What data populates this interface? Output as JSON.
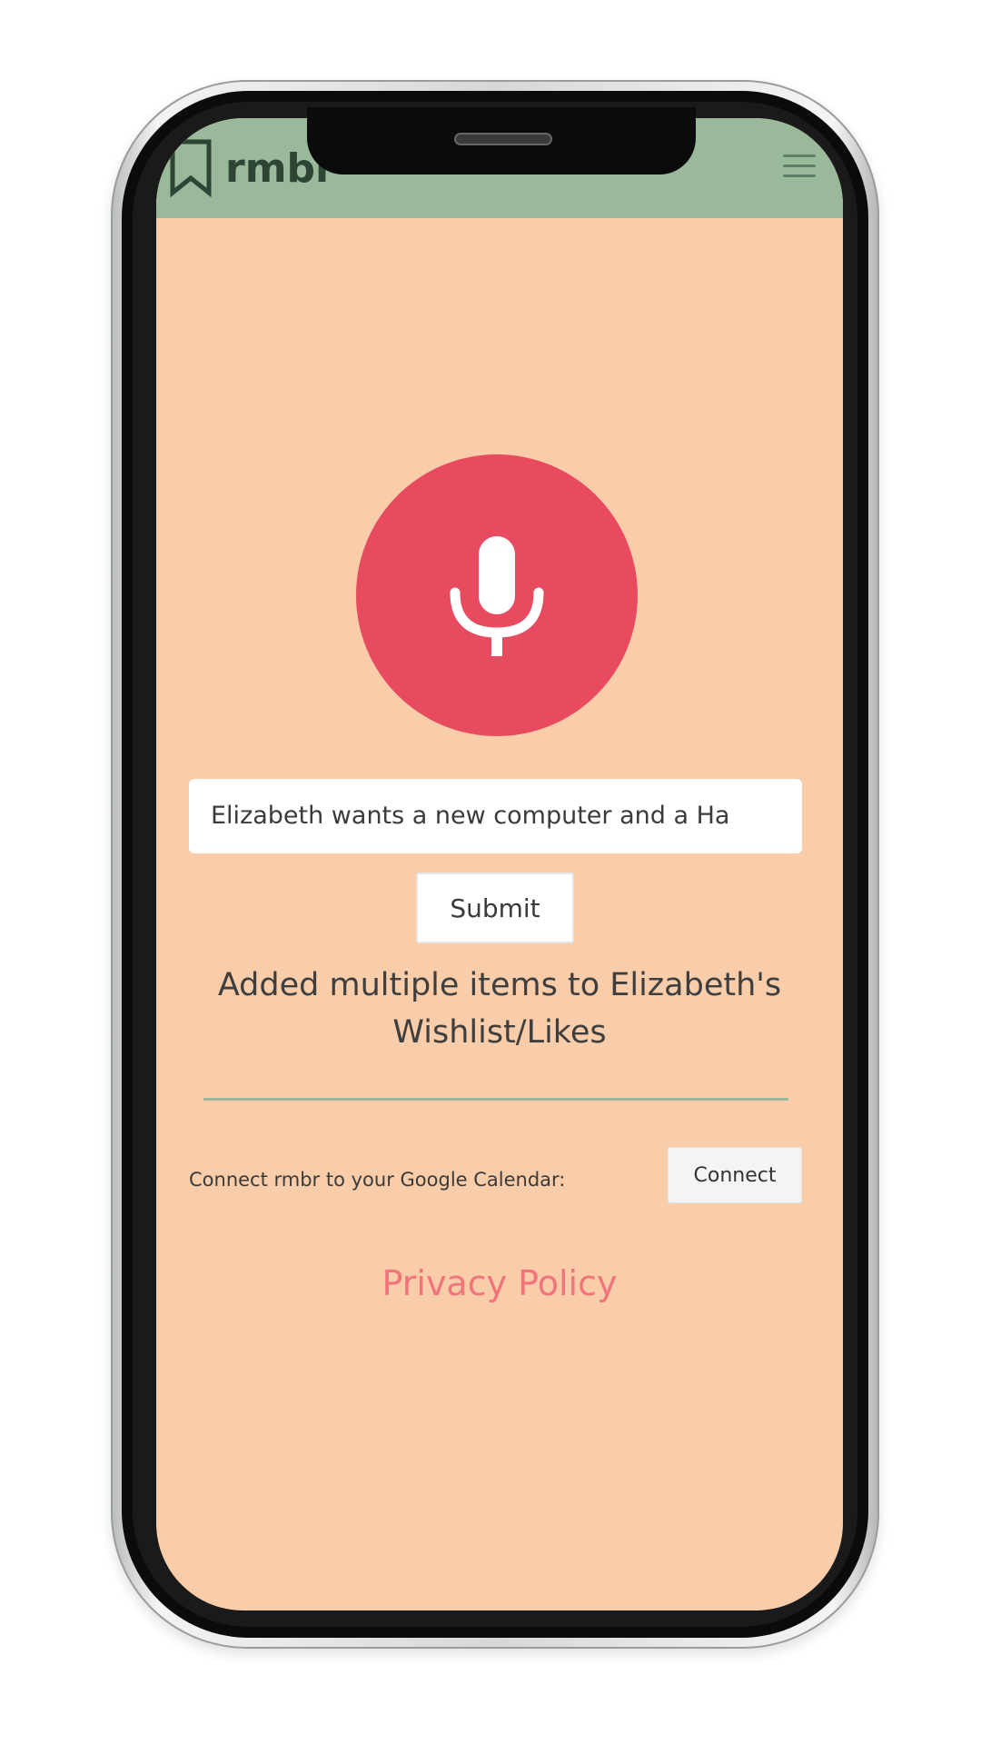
{
  "header": {
    "app_name": "rmbr",
    "logo_icon": "bookmark-icon",
    "menu_icon": "hamburger-menu-icon",
    "background_color": "#9ab99b"
  },
  "voice": {
    "mic_icon": "microphone-icon",
    "button_color": "#e84b60"
  },
  "entry": {
    "input_value": "Elizabeth wants a new computer and a Ha",
    "submit_label": "Submit"
  },
  "status": {
    "message": "Added multiple items to Elizabeth's Wishlist/Likes"
  },
  "calendar": {
    "label": "Connect rmbr to your Google Calendar:",
    "connect_label": "Connect"
  },
  "footer": {
    "privacy_link": "Privacy Policy",
    "link_color": "#f0747a"
  },
  "theme": {
    "page_background": "#f9cda9"
  }
}
